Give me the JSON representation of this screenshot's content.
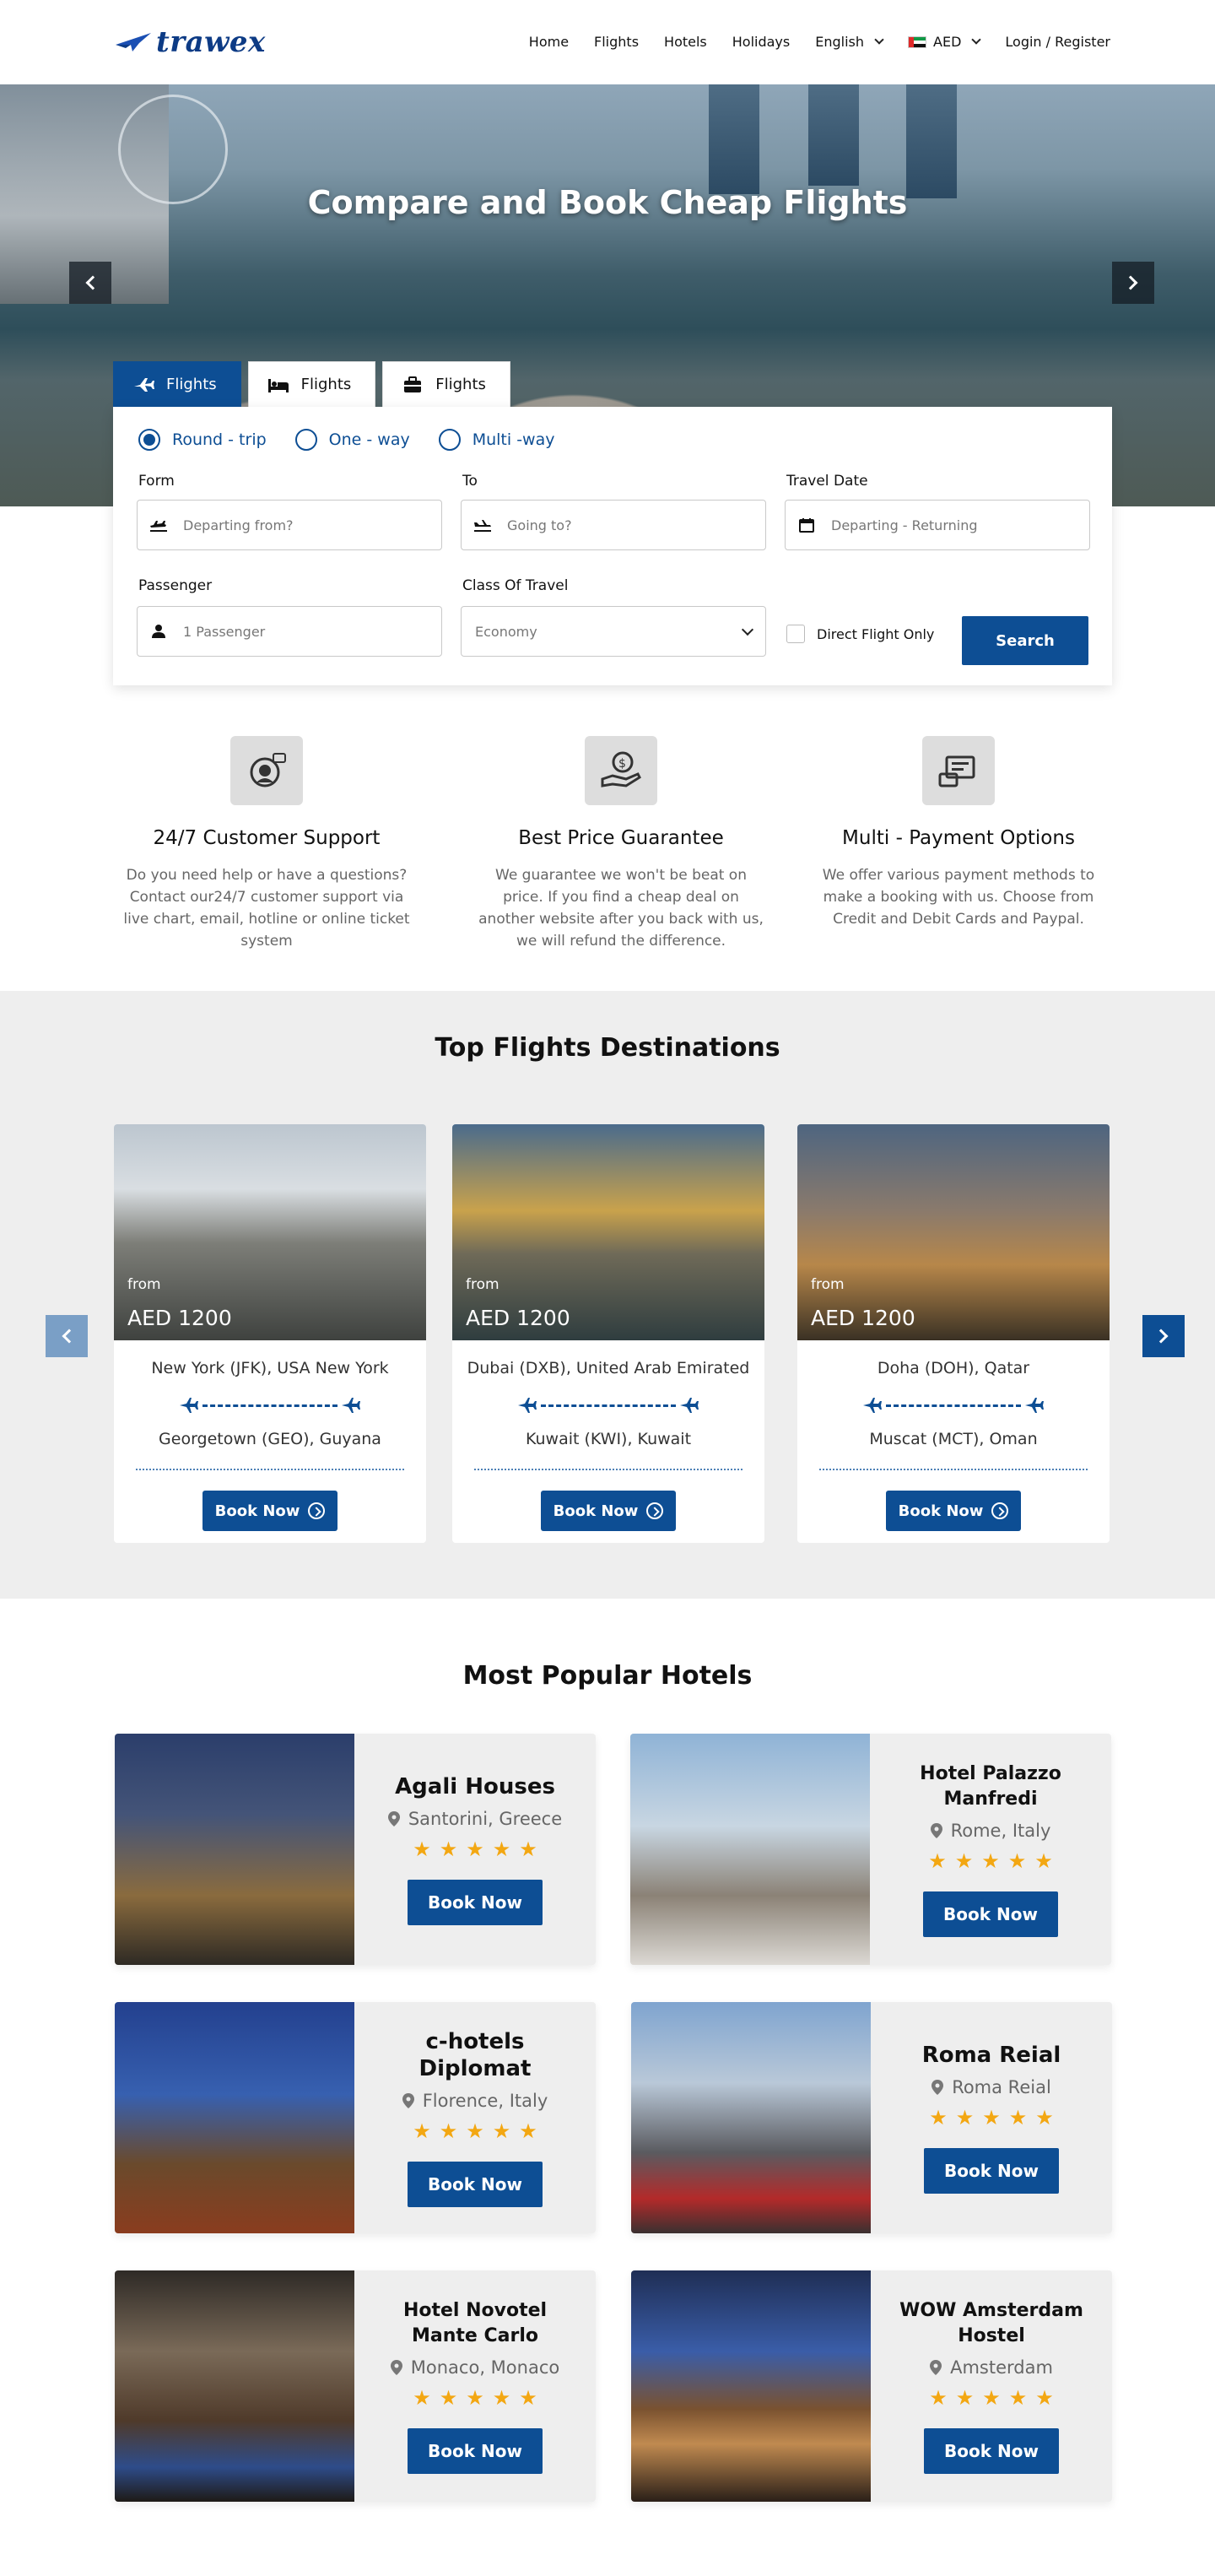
{
  "brand": {
    "name": "trawex",
    "color": "#0d3b85"
  },
  "nav": {
    "items": [
      "Home",
      "Flights",
      "Hotels",
      "Holidays"
    ],
    "language": "English",
    "currency": "AED",
    "login": "Login / Register"
  },
  "hero": {
    "title": "Compare and Book Cheap Flights"
  },
  "search": {
    "tabs": [
      {
        "label": "Flights",
        "icon": "plane-icon",
        "active": true
      },
      {
        "label": "Flights",
        "icon": "bed-icon",
        "active": false
      },
      {
        "label": "Flights",
        "icon": "briefcase-icon",
        "active": false
      }
    ],
    "trip_types": [
      {
        "label": "Round - trip",
        "selected": true
      },
      {
        "label": "One - way",
        "selected": false
      },
      {
        "label": "Multi -way",
        "selected": false
      }
    ],
    "from_label": "Form",
    "from_placeholder": "Departing from?",
    "to_label": "To",
    "to_placeholder": "Going to?",
    "date_label": "Travel Date",
    "date_placeholder": "Departing - Returning",
    "passenger_label": "Passenger",
    "passenger_value": "1 Passenger",
    "class_label": "Class Of Travel",
    "class_value": "Economy",
    "direct_label": "Direct Flight Only",
    "search_label": "Search",
    "accent": "#0d4e94"
  },
  "features": [
    {
      "title": "24/7  Customer  Support",
      "text": "Do you need help or have a questions? Contact our24/7 customer support via live chart, email, hotline or online ticket system",
      "icon": "support-agent-icon"
    },
    {
      "title": "Best Price Guarantee",
      "text": "We guarantee we won't be beat on price. If you find a cheap deal on another website after you back with us, we will refund the difference.",
      "icon": "hand-money-icon"
    },
    {
      "title": "Multi - Payment Options",
      "text": "We offer various payment methods to make a booking with us. Choose from Credit and Debit Cards and Paypal.",
      "icon": "payment-icon"
    }
  ],
  "destinations": {
    "title": "Top Flights Destinations",
    "cards": [
      {
        "from_text": "from",
        "price": "AED 1200",
        "origin": "New York (JFK), USA New York",
        "destination": "Georgetown (GEO), Guyana",
        "book": "Book Now"
      },
      {
        "from_text": "from",
        "price": "AED 1200",
        "origin": "Dubai (DXB), United Arab Emirated",
        "destination": "Kuwait (KWI), Kuwait",
        "book": "Book Now"
      },
      {
        "from_text": "from",
        "price": "AED 1200",
        "origin": "Doha (DOH), Qatar",
        "destination": "Muscat (MCT), Oman",
        "book": "Book Now"
      }
    ]
  },
  "hotels": {
    "title": "Most Popular Hotels",
    "items": [
      {
        "name": "Agali Houses",
        "location": "Santorini, Greece",
        "stars": 5,
        "book": "Book Now"
      },
      {
        "name": "Hotel Palazzo Manfredi",
        "location": "Rome, Italy",
        "stars": 5,
        "book": "Book Now"
      },
      {
        "name": "c-hotels Diplomat",
        "location": "Florence, Italy",
        "stars": 5,
        "book": "Book Now"
      },
      {
        "name": "Roma Reial",
        "location": "Roma Reial",
        "stars": 5,
        "book": "Book Now"
      },
      {
        "name": "Hotel Novotel Mante Carlo",
        "location": "Monaco, Monaco",
        "stars": 5,
        "book": "Book Now"
      },
      {
        "name": "WOW Amsterdam Hostel",
        "location": "Amsterdam",
        "stars": 5,
        "book": "Book Now"
      }
    ]
  }
}
